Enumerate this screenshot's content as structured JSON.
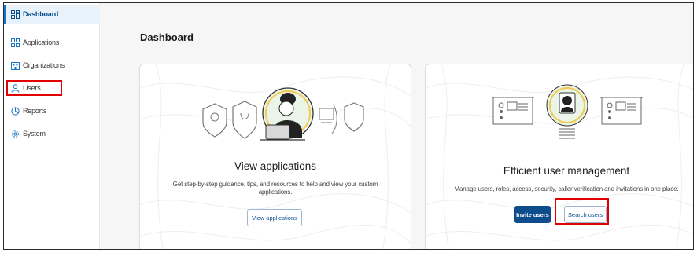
{
  "sidebar": {
    "items": [
      {
        "label": "Dashboard",
        "icon": "dashboard-icon",
        "active": true
      },
      {
        "label": "Applications",
        "icon": "applications-icon"
      },
      {
        "label": "Organizations",
        "icon": "organizations-icon"
      },
      {
        "label": "Users",
        "icon": "user-icon"
      },
      {
        "label": "Reports",
        "icon": "reports-icon"
      },
      {
        "label": "System",
        "icon": "gear-icon"
      }
    ]
  },
  "main": {
    "title": "Dashboard",
    "cards": [
      {
        "title": "View applications",
        "description": "Get step-by-step guidance, tips, and resources to help and view your custom applications.",
        "buttons": [
          {
            "label": "View applications",
            "style": "outline"
          }
        ]
      },
      {
        "title": "Efficient user management",
        "description": "Manage users, roles, access, security, caller verification and invitations in one place.",
        "buttons": [
          {
            "label": "Invite users",
            "style": "primary"
          },
          {
            "label": "Search users",
            "style": "outline"
          }
        ]
      }
    ]
  },
  "colors": {
    "accent": "#1a73c8",
    "primary_button": "#0f4c8b",
    "highlight": "#e00000",
    "active_nav_bg": "#e8f2fb",
    "illustration_accent": "#f3c94d"
  }
}
